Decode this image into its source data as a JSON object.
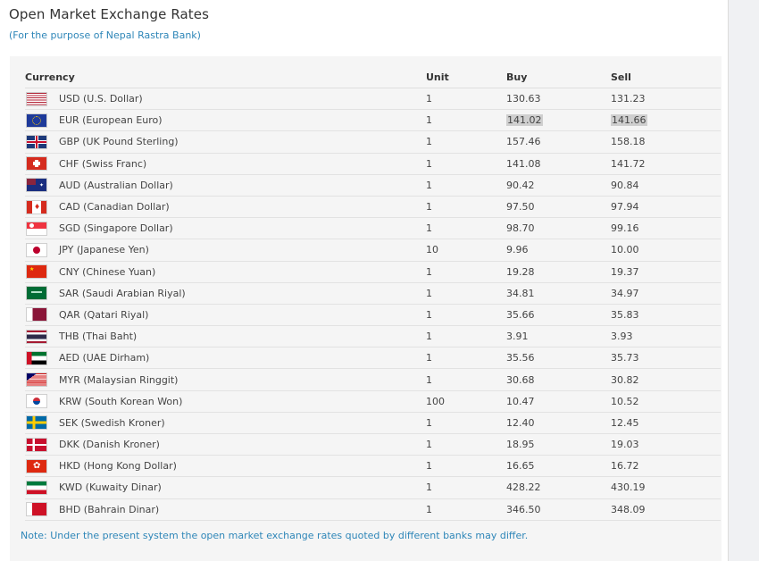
{
  "page": {
    "title": "Open Market Exchange Rates",
    "subtitle": "(For the purpose of Nepal Rastra Bank)"
  },
  "table": {
    "headers": {
      "currency": "Currency",
      "unit": "Unit",
      "buy": "Buy",
      "sell": "Sell"
    },
    "rows": [
      {
        "flag": "us-flag-icon",
        "currency": "USD (U.S. Dollar)",
        "unit": "1",
        "buy": "130.63",
        "sell": "131.23",
        "highlighted": false
      },
      {
        "flag": "eu-flag-icon",
        "currency": "EUR (European Euro)",
        "unit": "1",
        "buy": "141.02",
        "sell": "141.66",
        "highlighted": true
      },
      {
        "flag": "gb-flag-icon",
        "currency": "GBP (UK Pound Sterling)",
        "unit": "1",
        "buy": "157.46",
        "sell": "158.18",
        "highlighted": false
      },
      {
        "flag": "ch-flag-icon",
        "currency": "CHF (Swiss Franc)",
        "unit": "1",
        "buy": "141.08",
        "sell": "141.72",
        "highlighted": false
      },
      {
        "flag": "au-flag-icon",
        "currency": "AUD (Australian Dollar)",
        "unit": "1",
        "buy": "90.42",
        "sell": "90.84",
        "highlighted": false
      },
      {
        "flag": "ca-flag-icon",
        "currency": "CAD (Canadian Dollar)",
        "unit": "1",
        "buy": "97.50",
        "sell": "97.94",
        "highlighted": false
      },
      {
        "flag": "sg-flag-icon",
        "currency": "SGD (Singapore Dollar)",
        "unit": "1",
        "buy": "98.70",
        "sell": "99.16",
        "highlighted": false
      },
      {
        "flag": "jp-flag-icon",
        "currency": "JPY (Japanese Yen)",
        "unit": "10",
        "buy": "9.96",
        "sell": "10.00",
        "highlighted": false
      },
      {
        "flag": "cn-flag-icon",
        "currency": "CNY (Chinese Yuan)",
        "unit": "1",
        "buy": "19.28",
        "sell": "19.37",
        "highlighted": false
      },
      {
        "flag": "sa-flag-icon",
        "currency": "SAR (Saudi Arabian Riyal)",
        "unit": "1",
        "buy": "34.81",
        "sell": "34.97",
        "highlighted": false
      },
      {
        "flag": "qa-flag-icon",
        "currency": "QAR (Qatari Riyal)",
        "unit": "1",
        "buy": "35.66",
        "sell": "35.83",
        "highlighted": false
      },
      {
        "flag": "th-flag-icon",
        "currency": "THB (Thai Baht)",
        "unit": "1",
        "buy": "3.91",
        "sell": "3.93",
        "highlighted": false
      },
      {
        "flag": "ae-flag-icon",
        "currency": "AED (UAE Dirham)",
        "unit": "1",
        "buy": "35.56",
        "sell": "35.73",
        "highlighted": false
      },
      {
        "flag": "my-flag-icon",
        "currency": "MYR (Malaysian Ringgit)",
        "unit": "1",
        "buy": "30.68",
        "sell": "30.82",
        "highlighted": false
      },
      {
        "flag": "kr-flag-icon",
        "currency": "KRW (South Korean Won)",
        "unit": "100",
        "buy": "10.47",
        "sell": "10.52",
        "highlighted": false
      },
      {
        "flag": "se-flag-icon",
        "currency": "SEK (Swedish Kroner)",
        "unit": "1",
        "buy": "12.40",
        "sell": "12.45",
        "highlighted": false
      },
      {
        "flag": "dk-flag-icon",
        "currency": "DKK (Danish Kroner)",
        "unit": "1",
        "buy": "18.95",
        "sell": "19.03",
        "highlighted": false
      },
      {
        "flag": "hk-flag-icon",
        "currency": "HKD (Hong Kong Dollar)",
        "unit": "1",
        "buy": "16.65",
        "sell": "16.72",
        "highlighted": false
      },
      {
        "flag": "kw-flag-icon",
        "currency": "KWD (Kuwaity Dinar)",
        "unit": "1",
        "buy": "428.22",
        "sell": "430.19",
        "highlighted": false
      },
      {
        "flag": "bh-flag-icon",
        "currency": "BHD (Bahrain Dinar)",
        "unit": "1",
        "buy": "346.50",
        "sell": "348.09",
        "highlighted": false
      }
    ]
  },
  "note": "Note: Under the present system the open market exchange rates quoted by different banks may differ.",
  "colors": {
    "accent": "#2e86b8",
    "panel_bg": "#f5f5f5",
    "highlight": "#cfcfcf"
  }
}
